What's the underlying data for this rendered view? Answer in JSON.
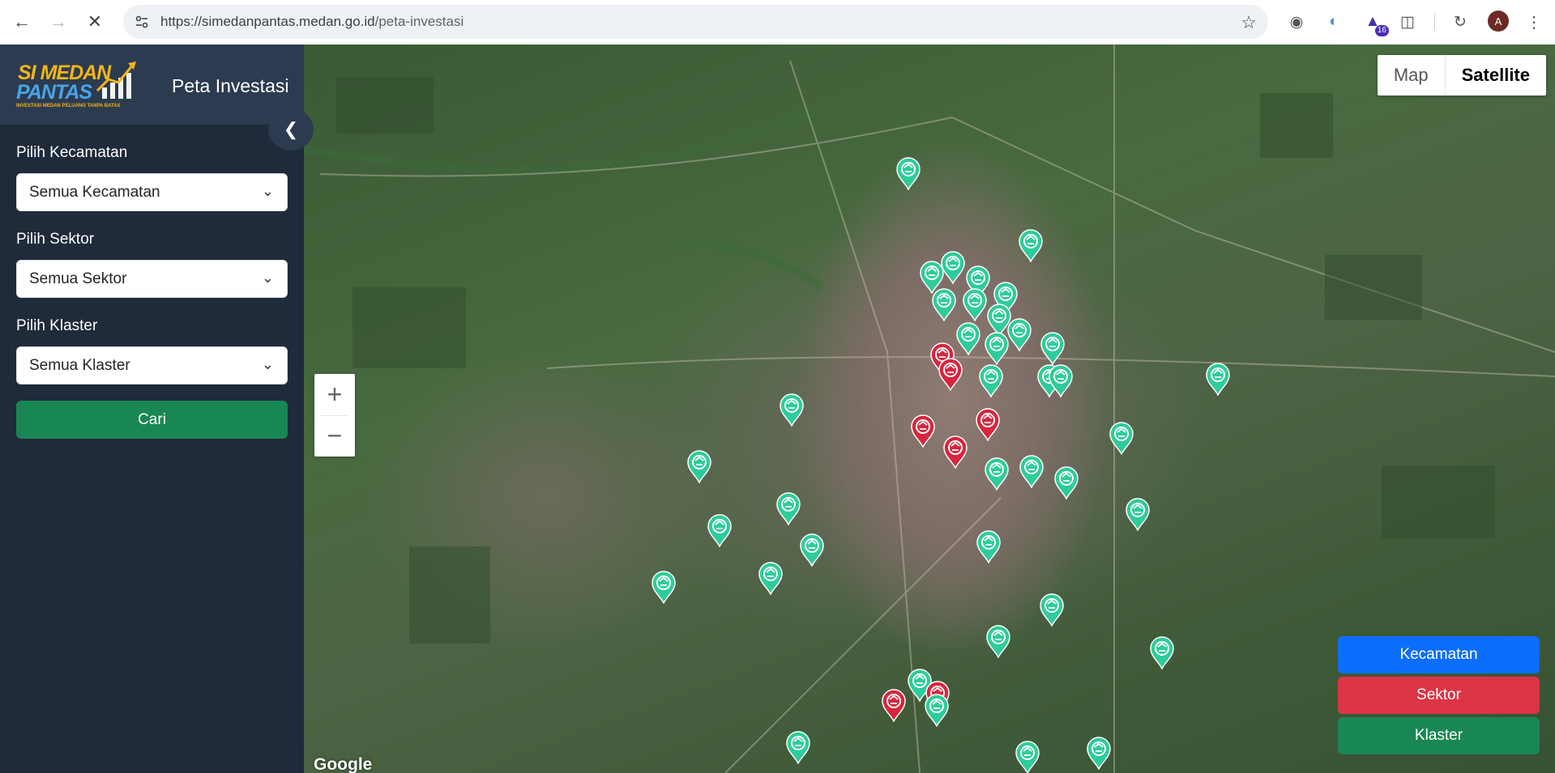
{
  "browser": {
    "url_host": "https://simedanpantas.medan.go.id",
    "url_path": "/peta-investasi",
    "extension_badge": "16",
    "profile_initial": "A",
    "icons": [
      "back-icon",
      "forward-icon",
      "stop-icon",
      "site-settings-icon",
      "bookmark-star-icon",
      "extension-icon",
      "puzzle-icon",
      "menu-dots-icon"
    ]
  },
  "sidebar": {
    "logo": {
      "line1": "SI MEDAN",
      "line2": "PANTAS",
      "tagline": "INVESTASI MEDAN PELUANG TANPA BATAS"
    },
    "title": "Peta Investasi",
    "filters": [
      {
        "label": "Pilih Kecamatan",
        "value": "Semua Kecamatan"
      },
      {
        "label": "Pilih Sektor",
        "value": "Semua Sektor"
      },
      {
        "label": "Pilih Klaster",
        "value": "Semua Klaster"
      }
    ],
    "search_button": "Cari"
  },
  "map": {
    "type_options": {
      "map": "Map",
      "satellite": "Satellite"
    },
    "active_type": "Satellite",
    "zoom_in": "+",
    "zoom_out": "−",
    "attribution": "Google",
    "legend": [
      {
        "label": "Kecamatan",
        "color": "#0d6efd"
      },
      {
        "label": "Sektor",
        "color": "#dc3545"
      },
      {
        "label": "Klaster",
        "color": "#198754"
      }
    ],
    "marker_colors": {
      "klaster": "#2ecc9a",
      "sektor": "#d7263d"
    }
  }
}
